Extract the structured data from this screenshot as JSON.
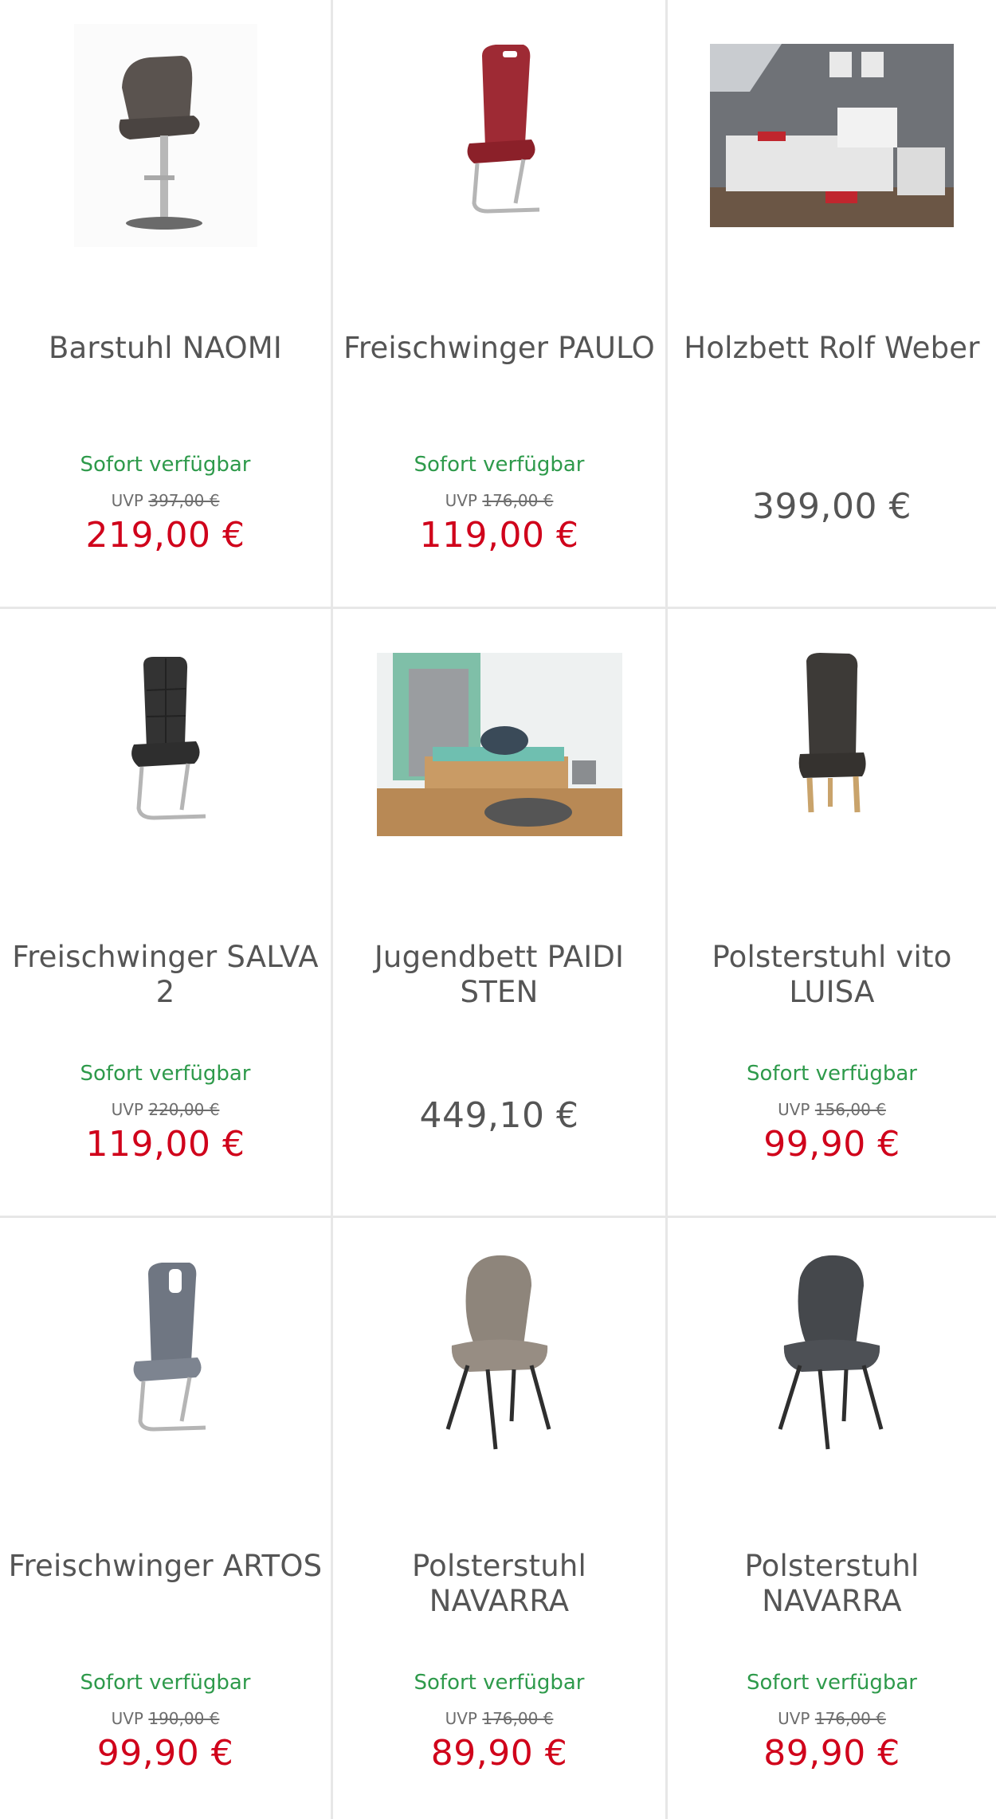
{
  "products": [
    {
      "title": "Barstuhl NAOMI",
      "availability": "Sofort verfügbar",
      "uvp_label": "UVP",
      "uvp": "397,00 €",
      "price": "219,00 €",
      "image": "bar-stool-image"
    },
    {
      "title": "Freischwinger PAULO",
      "availability": "Sofort verfügbar",
      "uvp_label": "UVP",
      "uvp": "176,00 €",
      "price": "119,00 €",
      "image": "red-cantilever-chair-image"
    },
    {
      "title": "Holzbett Rolf Weber",
      "price": "399,00 €",
      "image": "bedroom-photo-image"
    },
    {
      "title": "Freischwinger SALVA 2",
      "availability": "Sofort verfügbar",
      "uvp_label": "UVP",
      "uvp": "220,00 €",
      "price": "119,00 €",
      "image": "black-cantilever-chair-image"
    },
    {
      "title": "Jugendbett PAIDI STEN",
      "price": "449,10 €",
      "image": "youth-bedroom-photo-image"
    },
    {
      "title": "Polsterstuhl vito LUISA",
      "availability": "Sofort verfügbar",
      "uvp_label": "UVP",
      "uvp": "156,00 €",
      "price": "99,90 €",
      "image": "high-back-upholstered-chair-image"
    },
    {
      "title": "Freischwinger ARTOS",
      "availability": "Sofort verfügbar",
      "uvp_label": "UVP",
      "uvp": "190,00 €",
      "price": "99,90 €",
      "image": "grey-cantilever-chair-image"
    },
    {
      "title": "Polsterstuhl NAVARRA",
      "availability": "Sofort verfügbar",
      "uvp_label": "UVP",
      "uvp": "176,00 €",
      "price": "89,90 €",
      "image": "taupe-upholstered-chair-image"
    },
    {
      "title": "Polsterstuhl NAVARRA",
      "availability": "Sofort verfügbar",
      "uvp_label": "UVP",
      "uvp": "176,00 €",
      "price": "89,90 €",
      "image": "anthracite-upholstered-chair-image"
    }
  ],
  "colors": {
    "available": "#2e9a4b",
    "sale_price": "#d0021b",
    "regular_price": "#555555",
    "title": "#555555",
    "divider": "#e7e7e7"
  }
}
